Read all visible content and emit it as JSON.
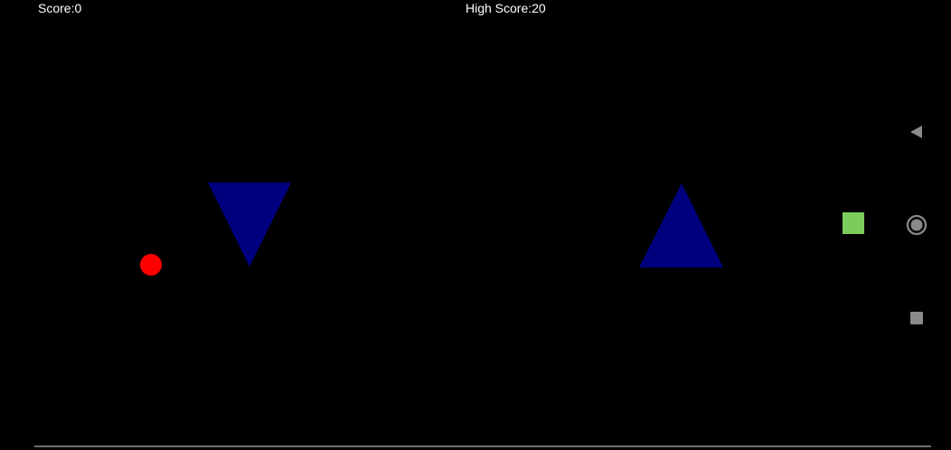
{
  "hud": {
    "score_label": "Score:0",
    "high_score_label": "High Score:20"
  },
  "colors": {
    "background": "#000000",
    "player": "#ff0000",
    "obstacle": "#00007f",
    "pickup": "#7ccc5c",
    "nav_icon": "#8a8a8a",
    "hud_text": "#ffffff"
  },
  "sprites": {
    "player": "red-ball",
    "obstacles": [
      "down-pointing-triangle",
      "up-pointing-triangle"
    ],
    "pickup": "green-square"
  },
  "nav": {
    "back_icon": "back-triangle",
    "home_icon": "home-circle",
    "recents_icon": "recents-square"
  }
}
